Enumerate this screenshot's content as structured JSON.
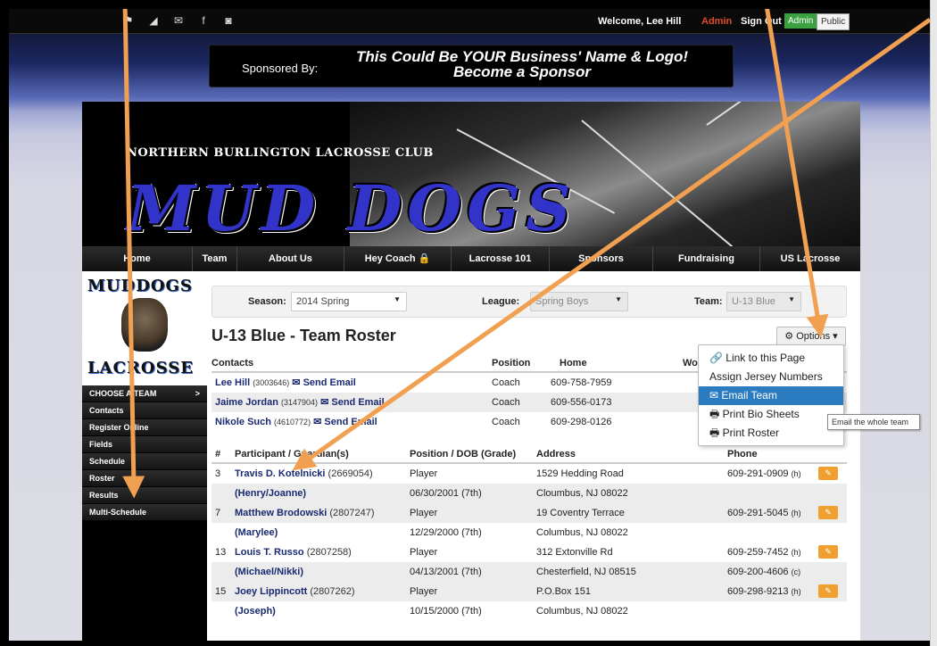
{
  "topbar": {
    "icons": [
      "flag-icon",
      "signal-icon",
      "mail-icon",
      "facebook-icon",
      "camera-icon"
    ],
    "welcome": "Welcome, Lee Hill",
    "admin": "Admin",
    "sign_out": "Sign Out",
    "toggle_admin": "Admin",
    "toggle_public": "Public"
  },
  "sponsor": {
    "by": "Sponsored By:",
    "line1": "This Could Be YOUR Business' Name & Logo!",
    "line2": "Become a Sponsor"
  },
  "header": {
    "club_name": "NORTHERN BURLINGTON LACROSSE CLUB",
    "logo_text": "MUD DOGS"
  },
  "nav": [
    {
      "label": "Home"
    },
    {
      "label": "Team"
    },
    {
      "label": "About Us"
    },
    {
      "label": "Hey Coach 🔒"
    },
    {
      "label": "Lacrosse 101"
    },
    {
      "label": "Sponsors"
    },
    {
      "label": "Fundraising"
    },
    {
      "label": "US Lacrosse"
    }
  ],
  "sidebar": {
    "logo_top": "MUDDOGS",
    "logo_bottom": "LACROSSE",
    "items": [
      {
        "label": "CHOOSE A TEAM",
        "chevron": ">"
      },
      {
        "label": "Contacts"
      },
      {
        "label": "Register Online"
      },
      {
        "label": "Fields"
      },
      {
        "label": "Schedule"
      },
      {
        "label": "Roster"
      },
      {
        "label": "Results"
      },
      {
        "label": "Multi-Schedule"
      }
    ]
  },
  "filters": {
    "season_label": "Season:",
    "season_value": "2014 Spring",
    "league_label": "League:",
    "league_value": "Spring Boys",
    "team_label": "Team:",
    "team_value": "U-13 Blue"
  },
  "page_title": "U-13 Blue - Team Roster",
  "options_button": "⚙ Options ▾",
  "contacts": {
    "headers": {
      "contacts": "Contacts",
      "position": "Position",
      "home": "Home",
      "work": "Wo"
    },
    "rows": [
      {
        "name": "Lee Hill",
        "id": "(3003646)",
        "email": "✉ Send Email",
        "position": "Coach",
        "home": "609-758-7959"
      },
      {
        "name": "Jaime Jordan",
        "id": "(3147904)",
        "email": "✉ Send Email",
        "position": "Coach",
        "home": "609-556-0173"
      },
      {
        "name": "Nikole Such",
        "id": "(4610772)",
        "email": "✉ Send Email",
        "position": "Coach",
        "home": "609-298-0126"
      }
    ]
  },
  "roster": {
    "headers": {
      "num": "#",
      "participant": "Participant / Guardian(s)",
      "position": "Position / DOB (Grade)",
      "address": "Address",
      "phone": "Phone"
    },
    "rows": [
      {
        "num": "3",
        "name": "Travis D. Kotelnicki",
        "id": "(2669054)",
        "position": "Player",
        "address": "1529 Hedding Road",
        "phone": "609-291-0909",
        "phone_tag": "(h)",
        "guardians": "(Henry/Joanne)",
        "dob": "06/30/2001 (7th)",
        "city": "Cloumbus, NJ 08022",
        "phone2": "",
        "phone2_tag": ""
      },
      {
        "num": "7",
        "name": "Matthew Brodowski",
        "id": "(2807247)",
        "position": "Player",
        "address": "19 Coventry Terrace",
        "phone": "609-291-5045",
        "phone_tag": "(h)",
        "guardians": "(Marylee)",
        "dob": "12/29/2000 (7th)",
        "city": "Columbus, NJ 08022",
        "phone2": "",
        "phone2_tag": ""
      },
      {
        "num": "13",
        "name": "Louis T. Russo",
        "id": "(2807258)",
        "position": "Player",
        "address": "312 Extonville Rd",
        "phone": "609-259-7452",
        "phone_tag": "(h)",
        "guardians": "(Michael/Nikki)",
        "dob": "04/13/2001 (7th)",
        "city": "Chesterfield, NJ 08515",
        "phone2": "609-200-4606",
        "phone2_tag": "(c)"
      },
      {
        "num": "15",
        "name": "Joey Lippincott",
        "id": "(2807262)",
        "position": "Player",
        "address": "P.O.Box 151",
        "phone": "609-298-9213",
        "phone_tag": "(h)",
        "guardians": "(Joseph)",
        "dob": "10/15/2000 (7th)",
        "city": "Columbus, NJ 08022",
        "phone2": "",
        "phone2_tag": ""
      }
    ]
  },
  "dropdown": {
    "items": [
      {
        "label": "🔗 Link to this Page"
      },
      {
        "label": "Assign Jersey Numbers"
      },
      {
        "label": "✉ Email Team"
      },
      {
        "label": "🖶 Print Bio Sheets"
      },
      {
        "label": "🖶 Print Roster"
      }
    ],
    "tooltip": "Email the whole team"
  },
  "colors": {
    "arrow": "#f0a050",
    "link": "#1a2a70",
    "active": "#2a7bc0",
    "logo_blue": "#3233c8"
  }
}
